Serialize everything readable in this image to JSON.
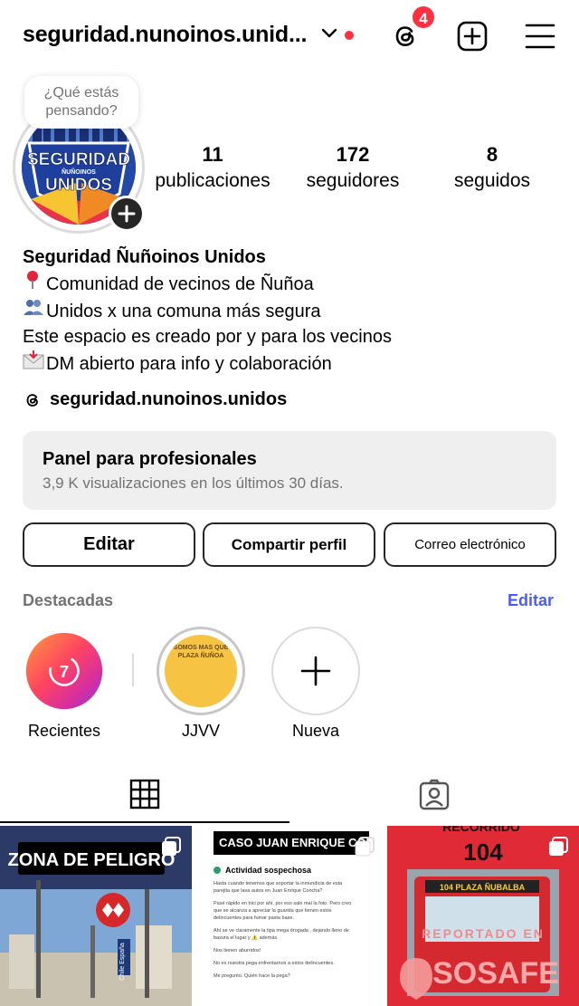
{
  "header": {
    "username": "seguridad.nunoinos.unid...",
    "notification_count": "4"
  },
  "profile": {
    "note": "¿Qué estás pensando?",
    "stats": [
      {
        "value": "11",
        "label": "publicaciones"
      },
      {
        "value": "172",
        "label": "seguidores"
      },
      {
        "value": "8",
        "label": "seguidos"
      }
    ],
    "name": "Seguridad Ñuñoinos Unidos",
    "bio": [
      {
        "icon": "pin-emoji",
        "text": "Comunidad de vecinos de Ñuñoa"
      },
      {
        "icon": "people-emoji",
        "text": "Unidos x una comuna más segura"
      },
      {
        "icon": "",
        "text": "Este espacio es creado por y para los vecinos"
      },
      {
        "icon": "envelope-emoji",
        "text": "DM abierto para info y colaboración"
      }
    ],
    "threads_handle": "seguridad.nunoinos.unidos",
    "avatar_text": [
      "SEGURIDAD",
      "ÑUÑOINOS",
      "UNIDOS"
    ]
  },
  "panel": {
    "title": "Panel para profesionales",
    "subtitle": "3,9 K visualizaciones en los últimos 30 días."
  },
  "buttons": {
    "edit": "Editar",
    "share": "Compartir perfil",
    "email": "Correo electrónico"
  },
  "highlights": {
    "title": "Destacadas",
    "edit": "Editar",
    "items": [
      {
        "label": "Recientes",
        "badge": "7"
      },
      {
        "label": "JJVV",
        "cover_text": "SOMOS MAS QUE PLAZA ÑUÑOA"
      },
      {
        "label": "Nueva"
      }
    ]
  },
  "posts": [
    {
      "caption": "ZONA DE PELIGRO",
      "sign_text": "Chile España"
    },
    {
      "caption": "CASO JUAN ENRIQUE CONCHA",
      "subtitle": "Actividad sospechosa",
      "paragraphs": [
        "Hasta cuando tenemos que soportar la inmundicia de esta parejita que lava autos en Juan Enrique Concha?",
        "Pasé rápido en bici por ahí, por eso sale mal la foto. Pero creo que se alcanza a apreciar la guarida que tienen estos delincuentes para fumar pasta base.",
        "Ahí se ve claramente la tipa mega drogada , dejando lleno de basura el lugar y ⚠️ además.",
        "Nos tienen aburridos!",
        "No es nuestra pega enfrentarnos a estos delincuentes.",
        "Me pregunto. Quién hace la pega?"
      ]
    },
    {
      "title_top": "RECORRIDO",
      "route": "104",
      "bus_sign": "104 PLAZA ÑUBALBA",
      "reported": "REPORTADO EN",
      "brand": "SOSAFE"
    }
  ],
  "colors": {
    "accent": "#4a5df9",
    "badge": "#ff3040",
    "panel_bg": "#efefef"
  }
}
